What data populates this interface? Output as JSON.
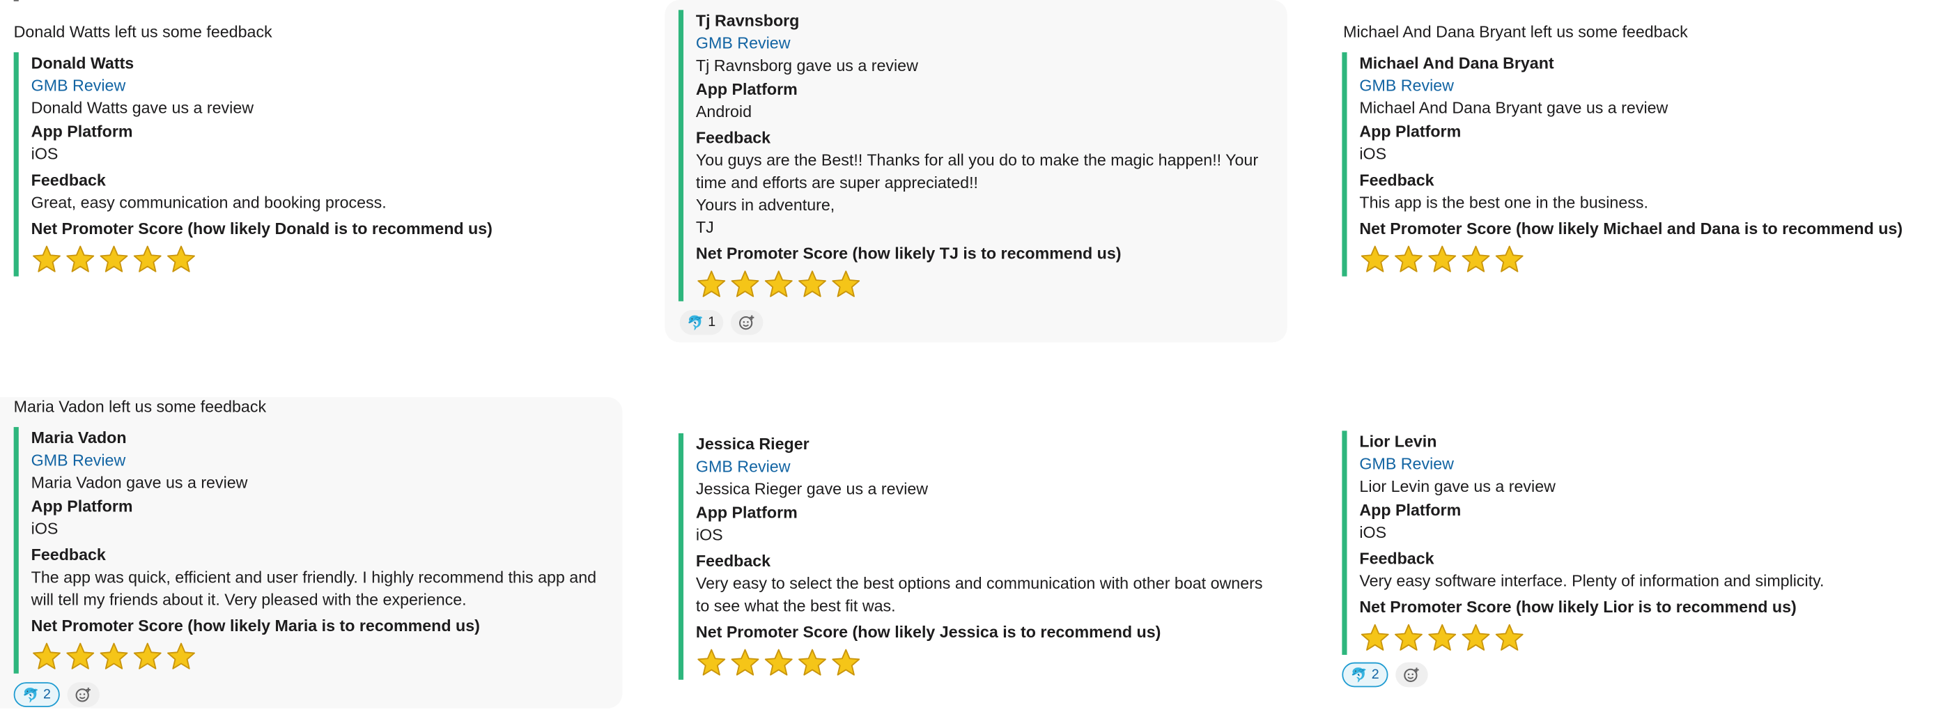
{
  "posts": [
    {
      "intro": "Donald Watts left us some feedback",
      "name": "Donald Watts",
      "source": "GMB Review",
      "summary": "Donald Watts gave us a review",
      "platform_label": "App Platform",
      "platform": "iOS",
      "feedback_label": "Feedback",
      "feedback": [
        "Great, easy communication and booking process."
      ],
      "nps_label": "Net Promoter Score (how likely Donald is to recommend us)",
      "rating": 5,
      "reactions": []
    },
    {
      "intro": "",
      "name": "Tj Ravnsborg",
      "source": "GMB Review",
      "summary": "Tj Ravnsborg gave us a review",
      "platform_label": "App Platform",
      "platform": "Android",
      "feedback_label": "Feedback",
      "feedback": [
        "You guys are the Best!! Thanks for all you do to make the magic happen!! Your time and efforts are super appreciated!!",
        "Yours in adventure,",
        "TJ"
      ],
      "nps_label": "Net Promoter Score (how likely TJ is to recommend us)",
      "rating": 5,
      "reactions": [
        {
          "emoji": "dolphin-icon",
          "count": "1",
          "active": false
        }
      ]
    },
    {
      "intro": "Michael And Dana Bryant left us some feedback",
      "name": "Michael And Dana Bryant",
      "source": "GMB Review",
      "summary": "Michael And Dana Bryant gave us a review",
      "platform_label": "App Platform",
      "platform": "iOS",
      "feedback_label": "Feedback",
      "feedback": [
        "This app is the best one in the business."
      ],
      "nps_label": "Net Promoter Score (how likely Michael and Dana is to recommend us)",
      "rating": 5,
      "reactions": []
    },
    {
      "intro": "Maria Vadon left us some feedback",
      "name": "Maria Vadon",
      "source": "GMB Review",
      "summary": "Maria Vadon gave us a review",
      "platform_label": "App Platform",
      "platform": "iOS",
      "feedback_label": "Feedback",
      "feedback": [
        "The app was quick, efficient and user friendly. I highly recommend this app and will tell my friends about it. Very pleased with the experience."
      ],
      "nps_label": "Net Promoter Score (how likely Maria is to recommend us)",
      "rating": 5,
      "reactions": [
        {
          "emoji": "dolphin-icon",
          "count": "2",
          "active": true
        }
      ]
    },
    {
      "intro": "",
      "name": "Jessica Rieger",
      "source": "GMB Review",
      "summary": "Jessica Rieger gave us a review",
      "platform_label": "App Platform",
      "platform": "iOS",
      "feedback_label": "Feedback",
      "feedback": [
        "Very easy to select the best options and communication with other boat owners to see what the best fit was."
      ],
      "nps_label": "Net Promoter Score (how likely Jessica is to recommend us)",
      "rating": 5,
      "reactions": []
    },
    {
      "intro": "",
      "name": "Lior Levin",
      "source": "GMB Review",
      "summary": "Lior Levin gave us a review",
      "platform_label": "App Platform",
      "platform": "iOS",
      "feedback_label": "Feedback",
      "feedback": [
        "Very easy software interface. Plenty of information and simplicity."
      ],
      "nps_label": "Net Promoter Score (how likely Lior is to recommend us)",
      "rating": 5,
      "reactions": [
        {
          "emoji": "dolphin-icon",
          "count": "2",
          "active": true
        }
      ]
    }
  ],
  "colors": {
    "accent_bar": "#2eb67d",
    "link": "#1264a3",
    "hover_bg": "#f8f8f8",
    "star": "#f5c518"
  },
  "icons": {
    "star": "star-icon",
    "add_reaction": "add-reaction-icon",
    "reaction": "dolphin-icon"
  }
}
